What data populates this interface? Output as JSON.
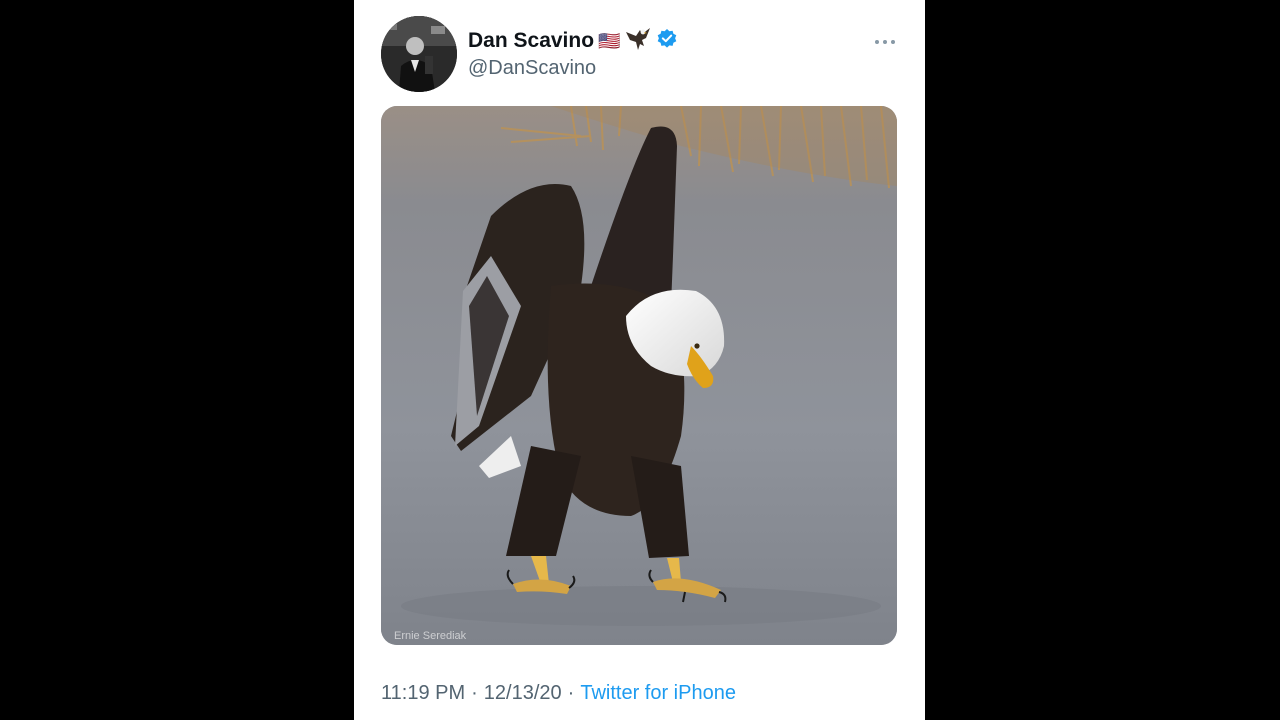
{
  "tweet": {
    "display_name": "Dan Scavino",
    "display_emojis": [
      "🇺🇸",
      "eagle"
    ],
    "verified": true,
    "handle": "@DanScavino",
    "media": {
      "subject": "bald eagle walking on ice",
      "watermark": "Ernie Serediak"
    },
    "time": "11:19 PM",
    "date": "12/13/20",
    "source": "Twitter for iPhone",
    "separator": "·"
  },
  "icons": {
    "more": "more-dots-icon",
    "verified": "verified-badge-icon",
    "eagle": "eagle-emoji-icon",
    "flag": "us-flag-emoji"
  },
  "colors": {
    "background": "#000000",
    "card": "#ffffff",
    "name": "#0f1419",
    "secondary": "#536471",
    "accent": "#1d9bf0"
  }
}
